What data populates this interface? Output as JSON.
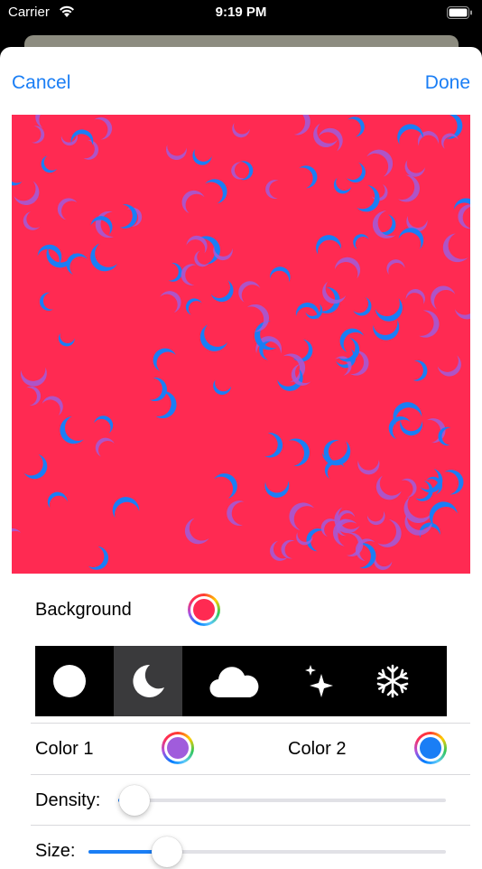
{
  "status_bar": {
    "carrier": "Carrier",
    "time": "9:19 PM"
  },
  "nav": {
    "cancel_label": "Cancel",
    "done_label": "Done"
  },
  "preview": {
    "background_color": "#ff2a52",
    "color1": "#a05cdc",
    "color2": "#1a7ef5",
    "shape": "moon"
  },
  "background_row": {
    "label": "Background",
    "color": "#ff2a52"
  },
  "shapes": [
    {
      "name": "circle-icon",
      "selected": false
    },
    {
      "name": "moon-icon",
      "selected": true
    },
    {
      "name": "cloud-icon",
      "selected": false
    },
    {
      "name": "sparkles-icon",
      "selected": false
    },
    {
      "name": "snowflake-icon",
      "selected": false
    }
  ],
  "colors_row": {
    "color1_label": "Color 1",
    "color1_value": "#a05cdc",
    "color2_label": "Color 2",
    "color2_value": "#1a7ef5"
  },
  "density": {
    "label": "Density:",
    "value": 0.05
  },
  "size": {
    "label": "Size:",
    "value": 0.22
  }
}
